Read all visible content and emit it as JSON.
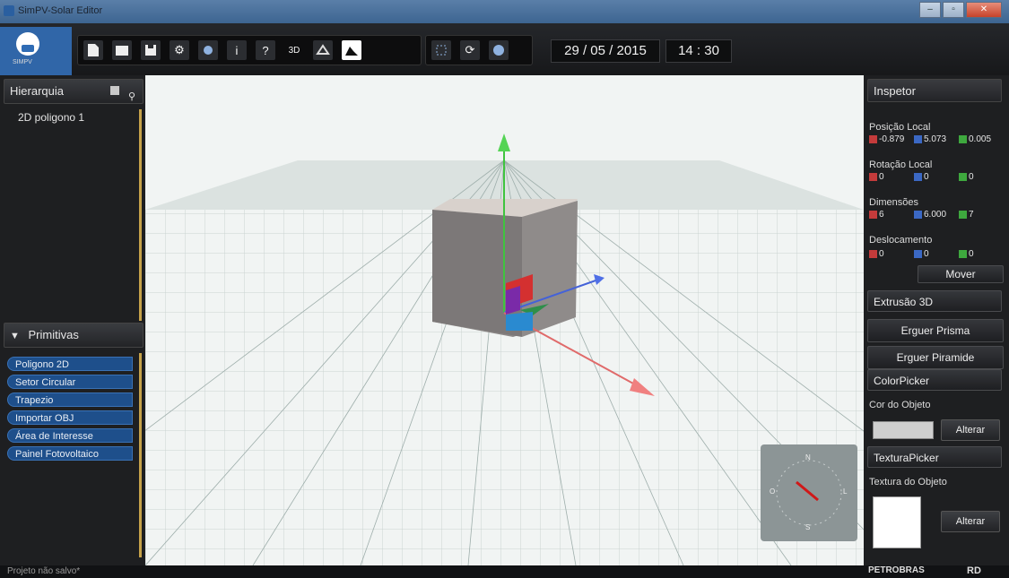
{
  "window": {
    "title": "SimPV-Solar Editor",
    "minimize": "–",
    "maximize": "▫",
    "close": "✕"
  },
  "logo": {
    "text": "SIMPV"
  },
  "toolbar": {
    "btn_3d": "3D",
    "info": "i",
    "help": "?",
    "date": "29 / 05 / 2015",
    "time": "14 : 30"
  },
  "hierarchy": {
    "title": "Hierarquia",
    "items": [
      "2D poligono 1"
    ]
  },
  "primitives": {
    "title": "Primitivas",
    "items": [
      "Poligono 2D",
      "Setor Circular",
      "Trapezio",
      "Importar OBJ",
      "Área de Interesse",
      "Painel Fotovoltaico"
    ]
  },
  "inspector": {
    "title": "Inspetor",
    "posicao": {
      "label": "Posição Local",
      "x": "-0.879",
      "y": "5.073",
      "z": "0.005"
    },
    "rotacao": {
      "label": "Rotação Local",
      "x": "0",
      "y": "0",
      "z": "0"
    },
    "dimensoes": {
      "label": "Dimensões",
      "x": "6",
      "y": "6.000",
      "z": "7"
    },
    "deslocamento": {
      "label": "Deslocamento",
      "x": "0",
      "y": "0",
      "z": "0"
    },
    "mover": "Mover",
    "extrusao": "Extrusão 3D",
    "erguer_prisma": "Erguer Prisma",
    "erguer_piramide": "Erguer Piramide",
    "colorpicker": "ColorPicker",
    "cor_objeto": "Cor do Objeto",
    "cor_alterar": "Alterar",
    "texturapicker": "TexturaPicker",
    "textura_objeto": "Textura do Objeto",
    "textura_alterar": "Alterar"
  },
  "compass": {
    "n": "N",
    "s": "S",
    "e": "L",
    "w": "O"
  },
  "status": {
    "text": "Projeto não salvo*",
    "brand1": "PETROBRAS",
    "brand2": "RD"
  },
  "colors": {
    "accent": "#1e4f8b",
    "viewport_bg": "#f1f4f3",
    "object_color": "#cfcfcf"
  }
}
